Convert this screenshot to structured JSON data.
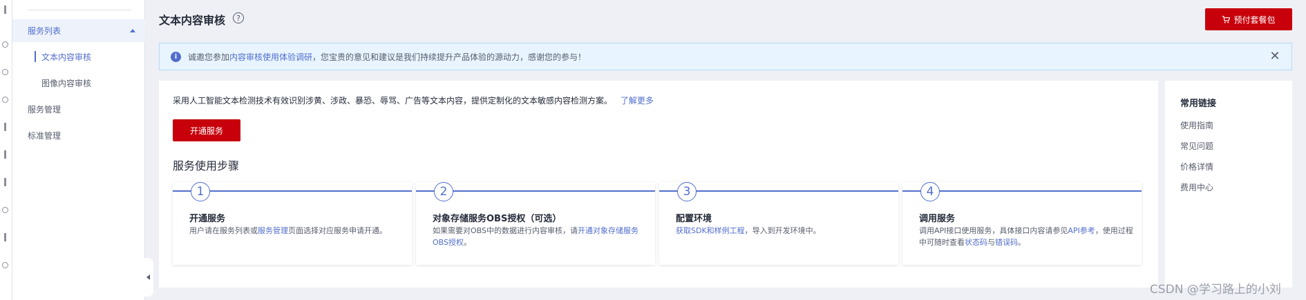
{
  "sidebar": {
    "group_label": "服务列表",
    "sub_items": [
      "文本内容审核",
      "图像内容审核"
    ],
    "items": [
      "服务管理",
      "标准管理"
    ]
  },
  "header": {
    "title": "文本内容审核",
    "help_icon": "question-circle-icon",
    "buy_label": "预付套餐包",
    "buy_icon": "cart-icon"
  },
  "notice": {
    "pre": "诚邀您参加",
    "link": "内容审核使用体验调研",
    "post": "，您宝贵的意见和建议是我们持续提升产品体验的源动力，感谢您的参与！",
    "icon": "info-icon",
    "close_icon": "close-icon"
  },
  "main": {
    "intro": "采用人工智能文本检测技术有效识别涉黄、涉政、暴恐、辱骂、广告等文本内容，提供定制化的文本敏感内容检测方案。",
    "learn_more": "了解更多",
    "open_button": "开通服务",
    "steps_title": "服务使用步骤",
    "steps": [
      {
        "num": "1",
        "title": "开通服务",
        "d1": "用户请在服务列表或",
        "l1": "服务管理",
        "d2": "页面选择对应服务申请开通。",
        "l2": "",
        "d3": ""
      },
      {
        "num": "2",
        "title": "对象存储服务OBS授权（可选）",
        "d1": "如果需要对OBS中的数据进行内容审核，请",
        "l1": "开通对象存储服务OBS授权",
        "d2": "。",
        "l2": "",
        "d3": ""
      },
      {
        "num": "3",
        "title": "配置环境",
        "d1": "",
        "l1": "获取SDK和样例工程",
        "d2": "，导入到开发环境中。",
        "l2": "",
        "d3": ""
      },
      {
        "num": "4",
        "title": "调用服务",
        "d1": "调用API接口使用服务，具体接口内容请参见",
        "l1": "API参考",
        "d2": "，使用过程中可随时查看",
        "l2": "状态码",
        "d3": "与",
        "l3": "错误码",
        "d4": "。"
      }
    ]
  },
  "links": {
    "title": "常用链接",
    "items": [
      "使用指南",
      "常见问题",
      "价格详情",
      "费用中心"
    ]
  },
  "watermark": "CSDN @学习路上的小刘",
  "colors": {
    "accent": "#526ecc",
    "brand": "#c7000b",
    "notice_bg": "#e8f4ff"
  }
}
